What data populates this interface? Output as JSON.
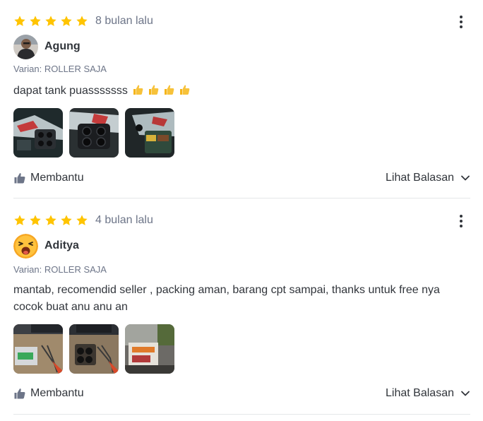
{
  "reviews": [
    {
      "rating": 5,
      "time": "8 bulan lalu",
      "user": "Agung",
      "variant": "Varian: ROLLER SAJA",
      "text": "dapat tank puasssssss",
      "emoji_count": 4,
      "photo_count": 3,
      "helpful_label": "Membantu",
      "replies_label": "Lihat Balasan"
    },
    {
      "rating": 5,
      "time": "4 bulan lalu",
      "user": "Aditya",
      "variant": "Varian: ROLLER SAJA",
      "text": "mantab, recomendid seller , packing aman, barang cpt sampai, thanks untuk free nya cocok buat anu anu an",
      "photo_count": 3,
      "helpful_label": "Membantu",
      "replies_label": "Lihat Balasan"
    }
  ],
  "colors": {
    "star": "#ffc400",
    "text": "#31353b",
    "muted": "#6d7588",
    "divider": "#e5e7e9"
  }
}
